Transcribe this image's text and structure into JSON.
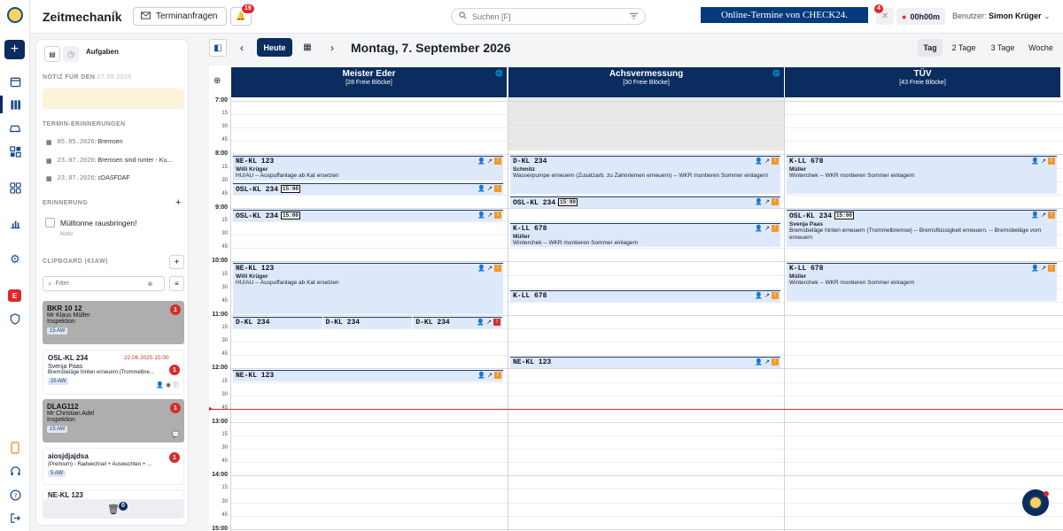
{
  "topbar": {
    "brand": "Zeitmechanik",
    "termin_label": "Terminanfragen",
    "notif_count": "19",
    "search_placeholder": "Suchen [F]",
    "promo": "Online-Termine von CHECK24.",
    "tools_badge": "4",
    "timer": "00h00m",
    "user_label": "Benutzer:",
    "user_name": "Simon Krüger"
  },
  "panel": {
    "tab_label": "Aufgaben",
    "note_header": "NOTIZ FÜR DEN",
    "note_date": "07.09.2026",
    "reminders_header": "TERMIN-ERINNERUNGEN",
    "reminders": [
      {
        "date": "05.05.2026",
        "text": ": Bremsen"
      },
      {
        "date": "23.07.2026",
        "text": ": Bremsen sind runter - Ku..."
      },
      {
        "date": "23.07.2026",
        "text": ": cDASFDAF"
      }
    ],
    "memo_header": "ERINNERUNG",
    "memo_title": "Mülltonne rausbringen!",
    "memo_sub": "Notiz",
    "clipboard_header": "CLIPBOARD (61AW)",
    "filter_placeholder": "Filter",
    "cards": [
      {
        "title": "BKR 10 12",
        "name": "Mr Klaus Müller",
        "desc": "Inspektion",
        "aw": "15 AW",
        "count": "1"
      },
      {
        "title": "OSL-KL 234",
        "due": "22.06.2025 15:00",
        "name": "Svenja Paas",
        "desc": "Bremsbeläge hinten erneuern (Trommelbre...",
        "aw": "25 AW",
        "count": "1"
      },
      {
        "title": "DLAG112",
        "name": "Mr Christian Adel",
        "desc": "Inspektion",
        "aw": "15 AW",
        "count": "1"
      },
      {
        "title": "aiosjdjajdsa",
        "desc": "(Premium) - Radwechsel + Auswuchten + ...",
        "aw": "5 AW",
        "count": "1"
      },
      {
        "title": "NE-KL 123"
      }
    ],
    "trash_count": "0"
  },
  "toolbar": {
    "today": "Heute",
    "date_title": "Montag, 7. September 2026",
    "views": [
      "Tag",
      "2 Tage",
      "3 Tage",
      "Woche"
    ],
    "active_view": "Tag"
  },
  "columns": [
    {
      "name": "Meister Eder",
      "free": "[28 Freie Blöcke]"
    },
    {
      "name": "Achsvermessung",
      "free": "[30 Freie Blöcke]"
    },
    {
      "name": "TÜV",
      "free": "[43 Freie Blöcke]"
    }
  ],
  "time_slots": [
    {
      "label": "7:00",
      "hour": true
    },
    {
      "label": "15"
    },
    {
      "label": "30"
    },
    {
      "label": "45"
    },
    {
      "label": "8:00",
      "hour": true
    },
    {
      "label": "15"
    },
    {
      "label": "30"
    },
    {
      "label": "45"
    },
    {
      "label": "9:00",
      "hour": true
    },
    {
      "label": "15"
    },
    {
      "label": "30"
    },
    {
      "label": "45"
    },
    {
      "label": "10:00",
      "hour": true
    },
    {
      "label": "15"
    },
    {
      "label": "30"
    },
    {
      "label": "45"
    },
    {
      "label": "11:00",
      "hour": true
    },
    {
      "label": "15"
    },
    {
      "label": "30"
    },
    {
      "label": "45"
    },
    {
      "label": "12:00",
      "hour": true
    },
    {
      "label": "15"
    },
    {
      "label": "30"
    },
    {
      "label": "45"
    },
    {
      "label": "13:00",
      "hour": true
    },
    {
      "label": "15"
    },
    {
      "label": "30"
    },
    {
      "label": "45"
    },
    {
      "label": "14:00",
      "hour": true
    },
    {
      "label": "15"
    },
    {
      "label": "30"
    },
    {
      "label": "45"
    },
    {
      "label": "15:00",
      "hour": true
    }
  ],
  "appointments": [
    {
      "col": 0,
      "start": "08:00",
      "end": "08:30",
      "plate": "NE-KL 123",
      "name": "Willi Krüger",
      "desc": "HU/AU -- Auspuffanlage ab Kat ersetzen",
      "chip": "o"
    },
    {
      "col": 0,
      "start": "08:30",
      "end": "08:45",
      "plate": "OSL-KL 234",
      "time": "15:00",
      "chip": "o"
    },
    {
      "col": 0,
      "start": "09:00",
      "end": "09:15",
      "plate": "OSL-KL 234",
      "time": "15:00",
      "chip": "o"
    },
    {
      "col": 0,
      "start": "10:00",
      "end": "11:00",
      "plate": "NE-KL 123",
      "name": "Willi Krüger",
      "desc": "HU/AU -- Auspuffanlage ab Kat ersetzen",
      "chip": "o"
    },
    {
      "col": 0,
      "start": "11:00",
      "end": "11:15",
      "plate": "D-KL 234",
      "sub": 0
    },
    {
      "col": 0,
      "start": "11:00",
      "end": "11:15",
      "plate": "D-KL 234",
      "sub": 1
    },
    {
      "col": 0,
      "start": "11:00",
      "end": "11:15",
      "plate": "D-KL 234",
      "sub": 2,
      "chip": "r"
    },
    {
      "col": 0,
      "start": "12:00",
      "end": "12:15",
      "plate": "NE-KL 123",
      "chip": "o"
    },
    {
      "col": 1,
      "start": "08:00",
      "end": "08:45",
      "plate": "D-KL 234",
      "name": "Schmitz",
      "desc": "Wasserpumpe erneuern (Zusatzarb. zu Zahnriemen erneuern) -- WKR montieren Sommer einlagern",
      "chip": "o"
    },
    {
      "col": 1,
      "start": "08:45",
      "end": "09:00",
      "plate": "OSL-KL 234",
      "time": "15:00",
      "chip": "o"
    },
    {
      "col": 1,
      "start": "09:15",
      "end": "09:45",
      "plate": "K-LL 678",
      "name": "Müller",
      "desc": "Winterchek -- WKR montieren Sommer einlagern",
      "chip": "o"
    },
    {
      "col": 1,
      "start": "10:30",
      "end": "10:45",
      "plate": "K-LL 678",
      "chip": "o"
    },
    {
      "col": 1,
      "start": "11:45",
      "end": "12:00",
      "plate": "NE-KL 123",
      "chip": "o"
    },
    {
      "col": 2,
      "start": "08:00",
      "end": "08:45",
      "plate": "K-LL 678",
      "name": "Müller",
      "desc": "Winterchek -- WKR montieren Sommer einlagern",
      "chip": "o"
    },
    {
      "col": 2,
      "start": "09:00",
      "end": "09:45",
      "plate": "OSL-KL 234",
      "time": "15:00",
      "name": "Svenja Paas",
      "desc": "Bremsbeläge hinten erneuern (Trommelbremse) -- Bremsflüssigkeit erneuern. -- Bremsbeläge vorn erneuern",
      "chip": "o"
    },
    {
      "col": 2,
      "start": "10:00",
      "end": "10:45",
      "plate": "K-LL 678",
      "name": "Müller",
      "desc": "Winterchek -- WKR montieren Sommer einlagern",
      "chip": "o"
    }
  ],
  "now": "12:45",
  "colors": {
    "navy": "#0a2c5e",
    "appt_bg": "#dde9fb",
    "now_line": "#e0262b",
    "badge_red": "#d62d2d",
    "chip_orange": "#f09a2a"
  }
}
